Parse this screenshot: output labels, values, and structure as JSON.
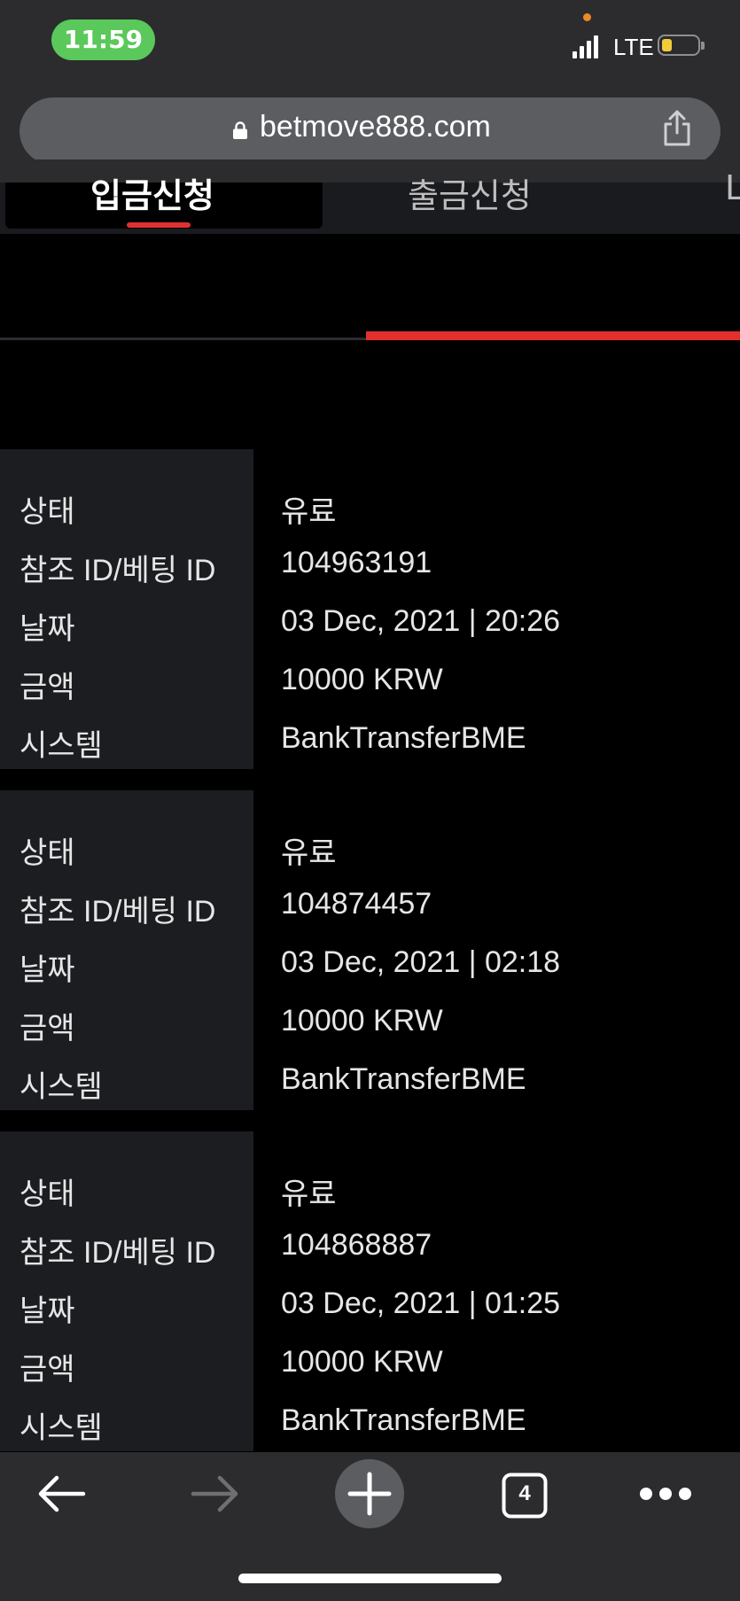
{
  "status_bar": {
    "time": "11:59",
    "network": "LTE",
    "battery_level": 0.3
  },
  "browser": {
    "url": "betmove888.com",
    "tab_count": "4"
  },
  "tabs": [
    {
      "label": "입금신청",
      "active": true
    },
    {
      "label": "출금신청",
      "active": false
    },
    {
      "label": "L",
      "active": false
    }
  ],
  "field_labels": {
    "status": "상태",
    "reference_id": "참조 ID/베팅 ID",
    "date": "날짜",
    "amount": "금액",
    "system": "시스템"
  },
  "records": [
    {
      "status": "유료",
      "reference_id": "104963191",
      "date": "03 Dec, 2021 | 20:26",
      "amount": "10000 KRW",
      "system": "BankTransferBME"
    },
    {
      "status": "유료",
      "reference_id": "104874457",
      "date": "03 Dec, 2021 | 02:18",
      "amount": "10000 KRW",
      "system": "BankTransferBME"
    },
    {
      "status": "유료",
      "reference_id": "104868887",
      "date": "03 Dec, 2021 | 01:25",
      "amount": "10000 KRW",
      "system": "BankTransferBME"
    }
  ],
  "colors": {
    "accent": "#e2302c",
    "panel": "#1c1d21",
    "chrome": "#2c2c2e"
  }
}
